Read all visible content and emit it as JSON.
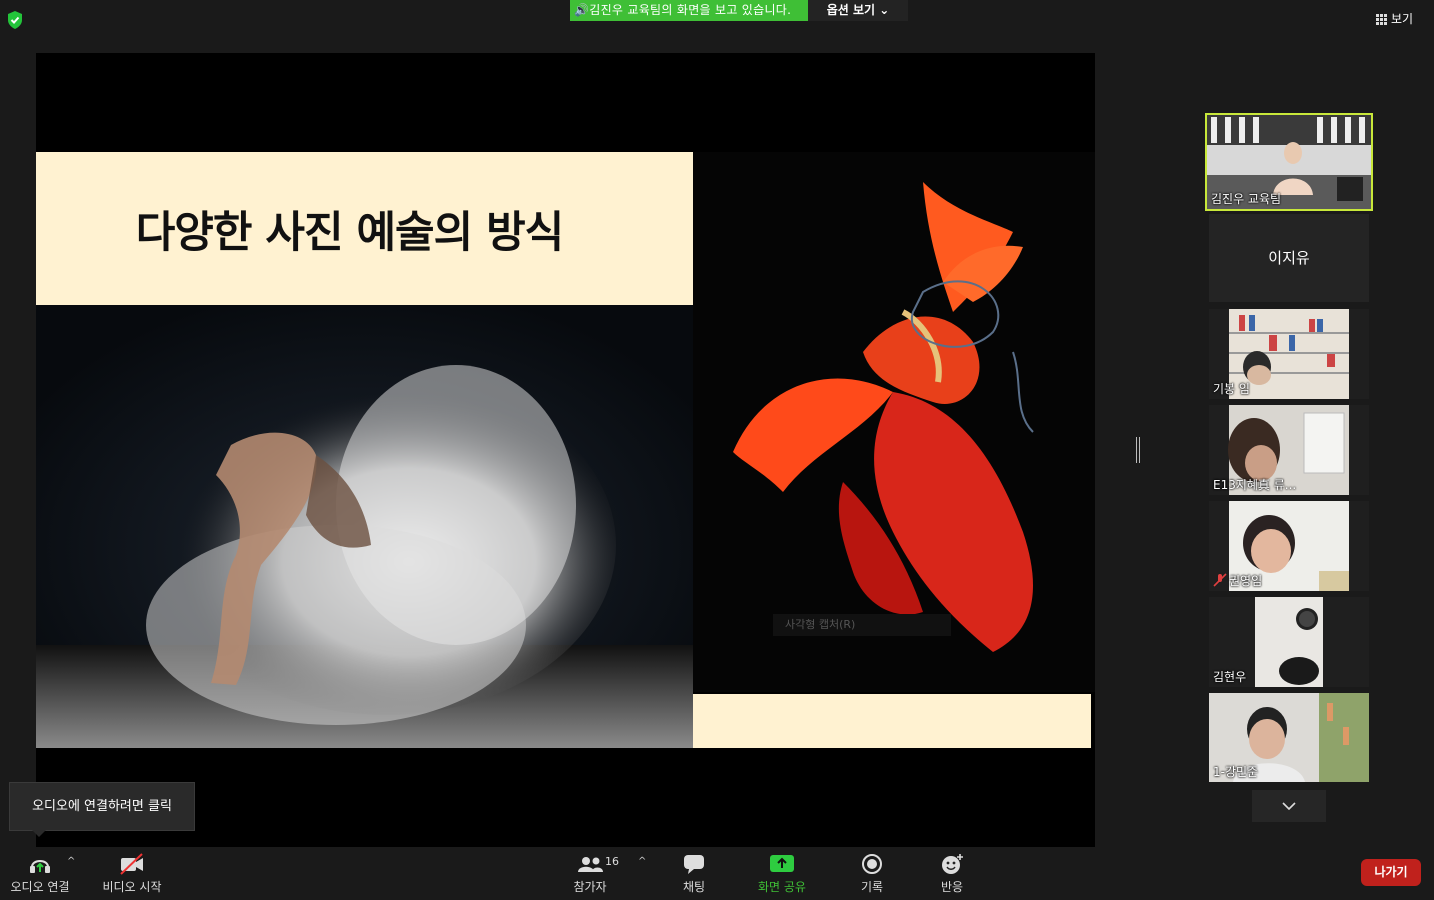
{
  "top_bar": {
    "share_banner": "🔊김진우 교육팀의 화면을 보고 있습니다.",
    "view_options": "옵션 보기 ⌄",
    "view_label": "보기"
  },
  "slide": {
    "title": "다양한 사진 예술의 방식",
    "capture_hint": "사각형 캡처(R)"
  },
  "participants": [
    {
      "name": "김진우 교육팀",
      "video": true,
      "active": true
    },
    {
      "name": "이지유",
      "video": false
    },
    {
      "name": "기봉 임",
      "video": true
    },
    {
      "name": "E13지혜真 류...",
      "video": true
    },
    {
      "name": "권영임",
      "video": true,
      "muted": true
    },
    {
      "name": "김현우",
      "video": true
    },
    {
      "name": "1-강민준",
      "video": true
    }
  ],
  "tooltip": {
    "text": "오디오에 연결하려면 클릭"
  },
  "toolbar": {
    "audio": "오디오 연결",
    "video": "비디오 시작",
    "participants": "참가자",
    "participant_count": "16",
    "chat": "채팅",
    "share": "화면 공유",
    "record": "기록",
    "reactions": "반응",
    "leave": "나가기"
  },
  "colors": {
    "share_green": "#3fbf36",
    "active_speaker": "#c8e83a",
    "leave_red": "#c0211c",
    "slide_band": "#fff2d1"
  }
}
